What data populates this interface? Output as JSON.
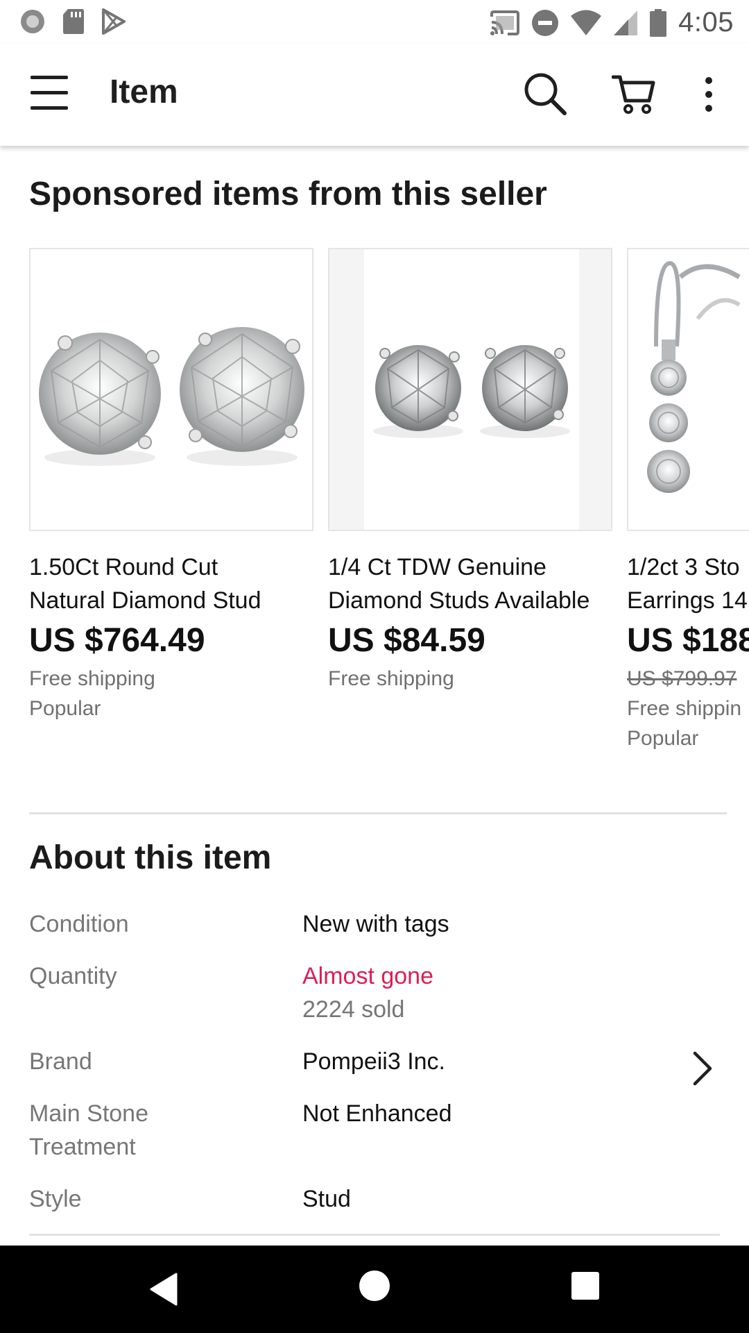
{
  "status_bar": {
    "time": "4:05",
    "left_icons": [
      "notification-dot-icon",
      "sd-card-icon",
      "play-store-icon"
    ],
    "right_icons": [
      "cast-icon",
      "do-not-disturb-icon",
      "wifi-icon",
      "signal-icon",
      "battery-icon"
    ]
  },
  "app_bar": {
    "title": "Item",
    "icons": [
      "menu-icon",
      "search-icon",
      "cart-icon",
      "more-vert-icon"
    ]
  },
  "sponsored": {
    "heading": "Sponsored items from this seller",
    "items": [
      {
        "title_line1": "1.50Ct Round Cut",
        "title_line2": "Natural Diamond Stud",
        "price": "US $764.49",
        "original_price": "",
        "shipping": "Free shipping",
        "badge": "Popular"
      },
      {
        "title_line1": "1/4 Ct TDW Genuine",
        "title_line2": "Diamond Studs Available",
        "price": "US $84.59",
        "original_price": "",
        "shipping": "Free shipping",
        "badge": ""
      },
      {
        "title_line1": "1/2ct 3 Sto",
        "title_line2": "Earrings 14",
        "price": "US $188",
        "original_price": "US $799.97",
        "shipping": "Free shippin",
        "badge": "Popular"
      }
    ]
  },
  "about": {
    "heading": "About this item",
    "rows": [
      {
        "label": "Condition",
        "value": "New with tags"
      },
      {
        "label": "Quantity",
        "value_alert": "Almost gone",
        "value_sub": "2224 sold"
      },
      {
        "label": "Brand",
        "value": "Pompeii3 Inc."
      },
      {
        "label_line1": "Main Stone",
        "label_line2": "Treatment",
        "value": "Not Enhanced"
      },
      {
        "label": "Style",
        "value": "Stud"
      }
    ]
  },
  "colors": {
    "alert": "#dd1e54",
    "text": "#111820",
    "muted": "#767676"
  },
  "nav_bar": {
    "icons": [
      "back-icon",
      "home-icon",
      "recents-icon"
    ]
  }
}
